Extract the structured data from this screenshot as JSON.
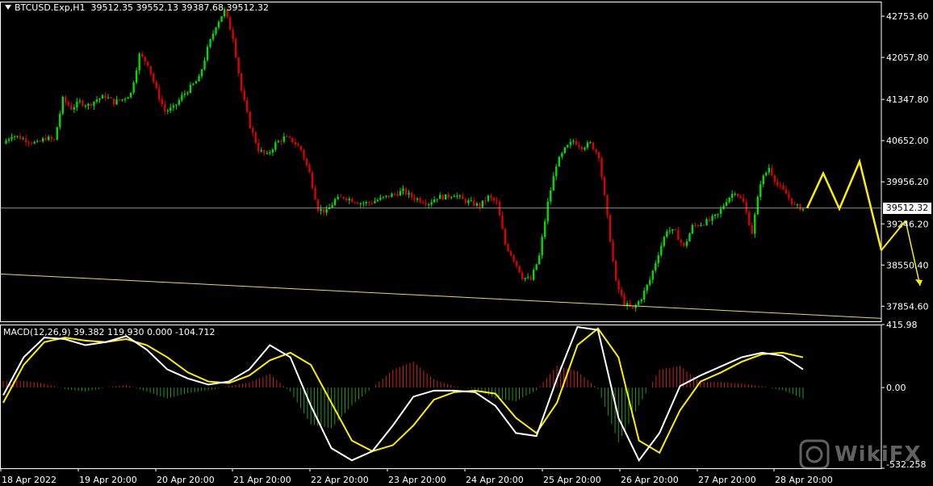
{
  "header": {
    "symbol": "BTCUSD.Exp,H1",
    "ohlc": "39512.35 39552.13 39387.68 39512.32"
  },
  "macd_header": {
    "label": "MACD(12,26,9) 39.382 119.930 0.000 -104.712"
  },
  "current_price_label": "39512.32",
  "watermark": {
    "text": "WikiFX"
  },
  "colors": {
    "bull": "#00dd00",
    "bear": "#dd0000",
    "grid": "#ffffff",
    "macd_main": "#ffffff",
    "macd_signal": "#ffee00",
    "hist_pos": "#cc2222",
    "hist_neg": "#229922",
    "annotation": "#ffee00"
  },
  "chart_data": [
    {
      "type": "candlestick",
      "ylim": [
        37600,
        43000
      ],
      "y_ticks": [
        42753.6,
        42057.8,
        41347.8,
        40652.0,
        39956.2,
        39246.2,
        38550.4,
        37854.6
      ],
      "y_tick_labels": [
        "42753.60",
        "42057.80",
        "41347.80",
        "40652.00",
        "39956.20",
        "39246.20",
        "38550.40",
        "37854.60"
      ],
      "current_price": 39512.32,
      "x_tick_labels": [
        "18 Apr 2022",
        "19 Apr 20:00",
        "20 Apr 20:00",
        "21 Apr 20:00",
        "22 Apr 20:00",
        "23 Apr 20:00",
        "24 Apr 20:00",
        "25 Apr 20:00",
        "26 Apr 20:00",
        "27 Apr 20:00",
        "28 Apr 20:00"
      ],
      "close_path": [
        40600,
        40750,
        40700,
        40650,
        40600,
        40700,
        40650,
        41350,
        41200,
        41300,
        41250,
        41350,
        41400,
        41300,
        41350,
        41450,
        42100,
        41950,
        41500,
        41150,
        41200,
        41400,
        41550,
        41700,
        42200,
        42600,
        42850,
        42400,
        41500,
        40900,
        40500,
        40400,
        40600,
        40700,
        40650,
        40500,
        40100,
        39500,
        39450,
        39650,
        39700,
        39650,
        39600,
        39600,
        39650,
        39700,
        39750,
        39800,
        39700,
        39650,
        39600,
        39700,
        39700,
        39750,
        39650,
        39600,
        39550,
        39700,
        39600,
        38900,
        38650,
        38350,
        38300,
        38700,
        39600,
        40250,
        40500,
        40650,
        40550,
        40600,
        40400,
        39350,
        38250,
        37900,
        37800,
        38000,
        38300,
        38750,
        39150,
        39100,
        38850,
        39200,
        39250,
        39300,
        39400,
        39650,
        39800,
        39600,
        39100,
        39950,
        40200,
        39900,
        39750,
        39550,
        39500
      ],
      "trendline": {
        "start_price": 38400,
        "end_price": 37650
      },
      "annotations": [
        {
          "type": "zigzag",
          "points": [
            [
              0,
              39512
            ],
            [
              1,
              40100
            ],
            [
              2,
              39500
            ],
            [
              3,
              40300
            ],
            [
              4,
              38800
            ]
          ]
        },
        {
          "type": "arrow",
          "from": 39300,
          "to": 38200
        }
      ]
    },
    {
      "type": "macd",
      "params": "MACD(12,26,9)",
      "values": {
        "main": 39.382,
        "signal": 119.93,
        "zero": 0.0,
        "hist": -104.712
      },
      "ylim": [
        -532.258,
        415.98
      ],
      "y_tick_labels": [
        "415.98",
        "0.00",
        "-532.258"
      ],
      "main_path": [
        -50,
        200,
        330,
        320,
        280,
        300,
        340,
        250,
        120,
        60,
        20,
        40,
        120,
        280,
        200,
        -120,
        -400,
        -480,
        -420,
        -250,
        -60,
        -20,
        -20,
        -30,
        -120,
        -300,
        -320,
        60,
        400,
        380,
        -200,
        -480,
        -300,
        10,
        80,
        140,
        200,
        230,
        210,
        120
      ],
      "signal_path": [
        -100,
        150,
        300,
        330,
        310,
        300,
        320,
        280,
        200,
        100,
        40,
        30,
        80,
        180,
        230,
        150,
        -100,
        -350,
        -420,
        -380,
        -250,
        -80,
        -30,
        -20,
        -40,
        -200,
        -300,
        -100,
        280,
        390,
        200,
        -350,
        -430,
        -150,
        40,
        100,
        170,
        220,
        230,
        200
      ]
    }
  ]
}
